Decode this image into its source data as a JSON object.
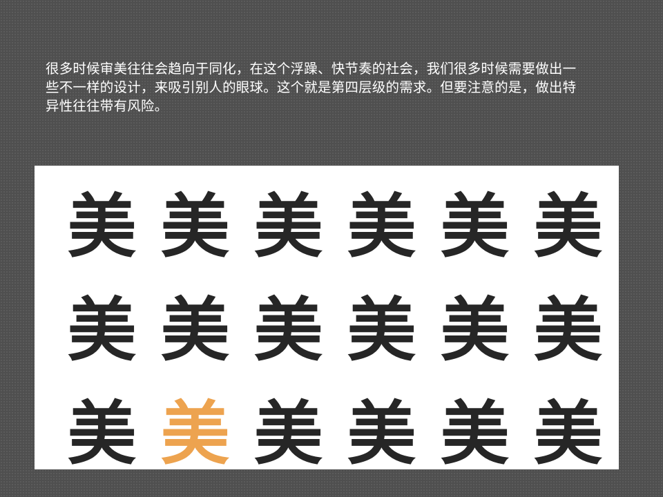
{
  "slide": {
    "paragraph_lines": [
      "很多时候审美往往会趋向于同化，在这个浮躁、快节奏的社会，我们很多时候需要做出一",
      "些不一样的设计，来吸引别人的眼球。这个就是第四层级的需求。但要注意的是，做出特",
      "异性往往带有风险。"
    ]
  },
  "illustration": {
    "glyph": "美",
    "default_color": "#262626",
    "highlight_color": "#eda34f",
    "rows": 3,
    "columns": 6,
    "highlight": {
      "row": 3,
      "column": 2
    }
  }
}
